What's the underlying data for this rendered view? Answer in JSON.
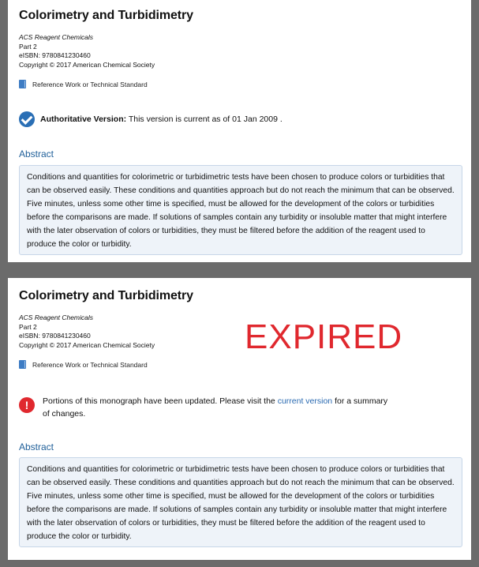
{
  "top_panel": {
    "title": "Colorimetry and Turbidimetry",
    "series": "ACS Reagent Chemicals",
    "part": "Part 2",
    "eisbn": "eISBN: 9780841230460",
    "copyright": "Copyright © 2017 American Chemical Society",
    "doc_type": "Reference Work or Technical Standard",
    "status_label": "Authoritative Version:",
    "status_text": " This version is current as of 01 Jan 2009 .",
    "abstract_heading": "Abstract",
    "abstract_text": "Conditions and quantities for colorimetric or turbidimetric tests have been chosen to produce colors or turbidities that can be observed easily. These conditions and quantities approach but do not reach the minimum that can be observed. Five minutes, unless some other time is specified, must be allowed for the development of the colors or turbidities before the comparisons are made. If solutions of samples contain any turbidity or insoluble matter that might interfere with the later observation of colors or turbidities, they must be filtered before the addition of the reagent used to produce the color or turbidity."
  },
  "bottom_panel": {
    "title": "Colorimetry and Turbidimetry",
    "series": "ACS Reagent Chemicals",
    "part": "Part 2",
    "eisbn": "eISBN: 9780841230460",
    "copyright": "Copyright © 2017 American Chemical Society",
    "doc_type": "Reference Work or Technical Standard",
    "expired_label": "EXPIRED",
    "warning_before": "Portions of this monograph have been updated. Please visit the ",
    "warning_link": "current version",
    "warning_after": " for a summary of changes.",
    "abstract_heading": "Abstract",
    "abstract_text": "Conditions and quantities for colorimetric or turbidimetric tests have been chosen to produce colors or turbidities that can be observed easily. These conditions and quantities approach but do not reach the minimum that can be observed. Five minutes, unless some other time is specified, must be allowed for the development of the colors or turbidities before the comparisons are made. If solutions of samples contain any turbidity or insoluble matter that might interfere with the later observation of colors or turbidities, they must be filtered before the addition of the reagent used to produce the color or turbidity."
  },
  "icons": {
    "doc_type_icon": "book-icon",
    "authoritative_icon": "check-circle-icon",
    "warning_icon": "exclamation-circle-icon"
  },
  "colors": {
    "link_blue": "#2a6ab1",
    "check_blue": "#2a6fb5",
    "expired_red": "#e0282e",
    "abstract_bg": "#eef3f9",
    "frame_gray": "#6b6b6b"
  }
}
